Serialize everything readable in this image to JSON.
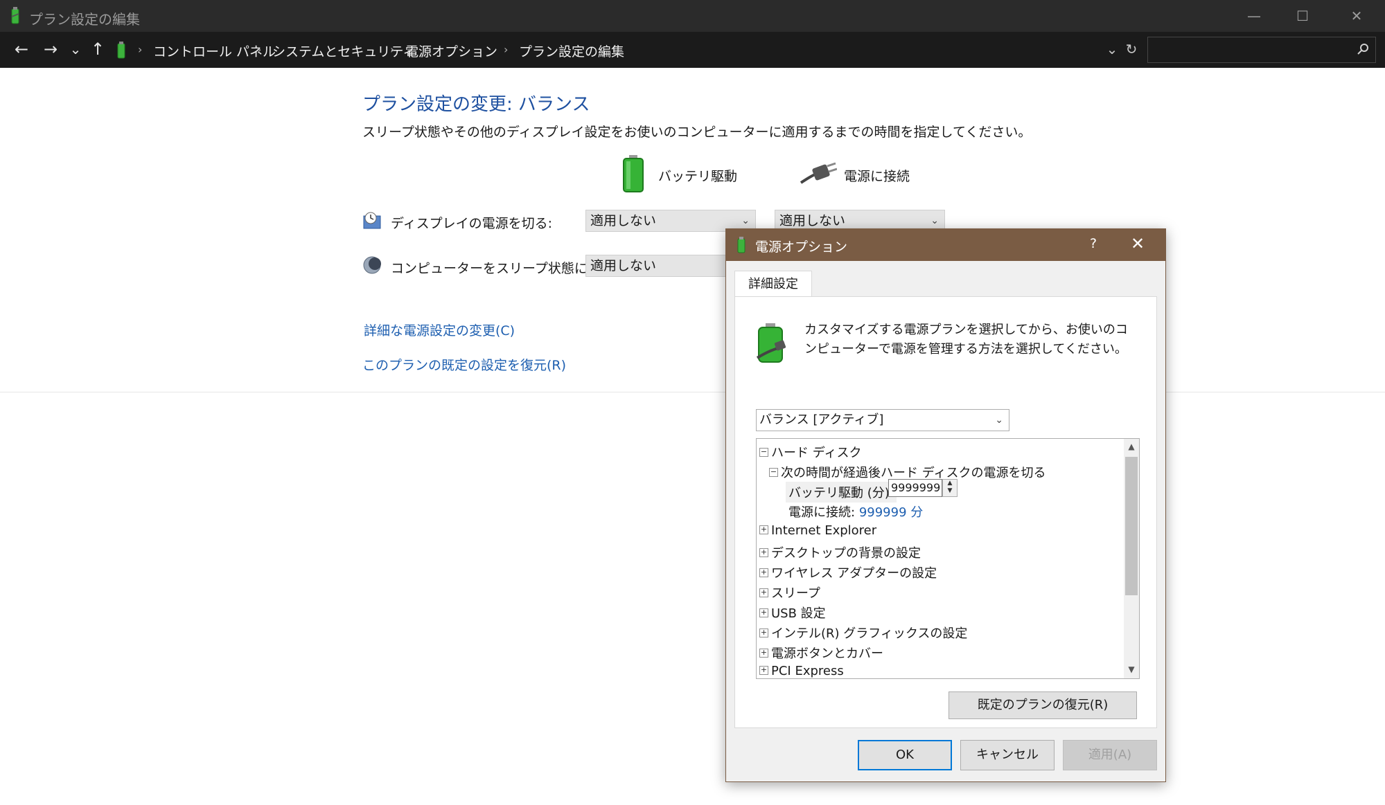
{
  "window": {
    "title": "プラン設定の編集",
    "controls": {
      "minimize": "—",
      "maximize": "☐",
      "close": "✕"
    }
  },
  "nav": {
    "back": "←",
    "forward": "→",
    "recent": "⌄",
    "up": "↑",
    "dropdown": "⌄",
    "refresh": "↻"
  },
  "breadcrumb": {
    "items": [
      "コントロール パネル",
      "システムとセキュリティ",
      "電源オプション",
      "プラン設定の編集"
    ],
    "separator": "›"
  },
  "search": {
    "placeholder": "",
    "icon": "search-icon"
  },
  "main": {
    "title": "プラン設定の変更: バランス",
    "description": "スリープ状態やその他のディスプレイ設定をお使いのコンピューターに適用するまでの時間を指定してください。",
    "columns": {
      "battery": "バッテリ駆動",
      "plugged": "電源に接続"
    },
    "rows": [
      {
        "label": "ディスプレイの電源を切る:",
        "battery": "適用しない",
        "plugged": "適用しない"
      },
      {
        "label": "コンピューターをスリープ状態にする:",
        "battery": "適用しない"
      }
    ],
    "links": {
      "advanced": "詳細な電源設定の変更(C)",
      "restore": "このプランの既定の設定を復元(R)"
    }
  },
  "dialog": {
    "title": "電源オプション",
    "help": "?",
    "close": "✕",
    "tab": "詳細設定",
    "description": "カスタマイズする電源プランを選択してから、お使いのコンピューターで電源を管理する方法を選択してください。",
    "plan": "バランス [アクティブ]",
    "tree": {
      "hard_disk": "ハード ディスク",
      "turn_off_after": "次の時間が経過後ハード ディスクの電源を切る",
      "battery_label": "バッテリ駆動 (分):",
      "battery_value": "9999999",
      "plugged_label": "電源に接続:",
      "plugged_value": "999999 分",
      "items": [
        "Internet Explorer",
        "デスクトップの背景の設定",
        "ワイヤレス アダプターの設定",
        "スリープ",
        "USB 設定",
        "インテル(R) グラフィックスの設定",
        "電源ボタンとカバー",
        "PCI Express"
      ]
    },
    "restore_button": "既定のプランの復元(R)",
    "ok": "OK",
    "cancel": "キャンセル",
    "apply": "適用(A)"
  },
  "colors": {
    "dialog_title_bar": "#7a5c44",
    "link": "#1e5fb0",
    "heading": "#1e50a0",
    "titlebar": "#2b2b2b",
    "addressbar": "#1b1b1b"
  }
}
